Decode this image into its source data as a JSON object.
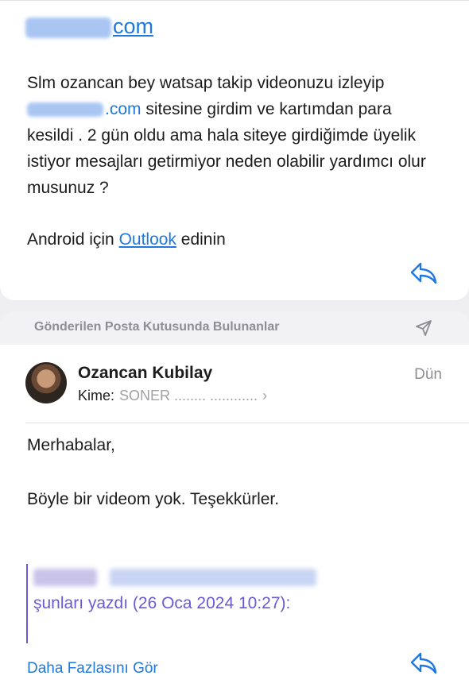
{
  "first_message": {
    "link_text": "com",
    "body_line1": "Slm ozancan bey watsap takip videonuzu izleyip",
    "body_link": ".com",
    "body_rest": " sitesine girdim ve kartımdan para kesildi . 2 gün oldu ama hala siteye girdiğimde üyelik istiyor mesajları getirmiyor neden olabilir yardımcı olur musunuz ?",
    "signature_prefix": "Android için ",
    "signature_link": "Outlook",
    "signature_suffix": " edinin"
  },
  "section": {
    "title": "Gönderilen Posta Kutusunda Bulunanlar",
    "icon": "send-icon"
  },
  "reply_message": {
    "sender": "Ozancan Kubilay",
    "date": "Dün",
    "to_label": "Kime:",
    "to_value": "SONER ........ ............",
    "greeting": "Merhabalar,",
    "body": "Böyle bir videom yok. Teşekkürler.",
    "quote_header": "şunları yazdı (26 Oca 2024 10:27):",
    "more_label": "Daha Fazlasını Gör"
  },
  "colors": {
    "accent": "#1f78e0",
    "quote": "#6a5ad6",
    "secondary_text": "#8e8e93"
  }
}
